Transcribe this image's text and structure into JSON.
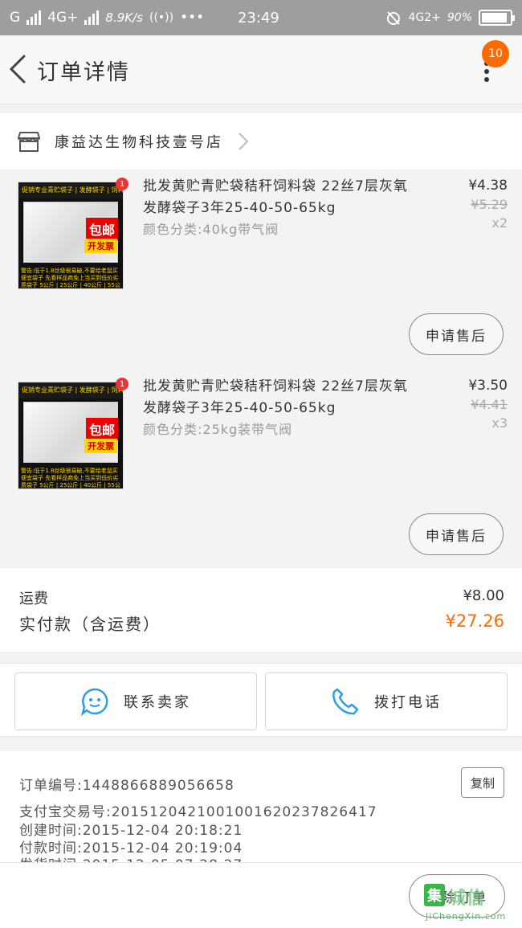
{
  "status_bar": {
    "carrier": "G",
    "net_type": "4G+",
    "speed": "8.9K/s",
    "dots": "•••",
    "time": "23:49",
    "net_type_right": "4G2+",
    "battery": "90%"
  },
  "nav": {
    "title": "订单详情",
    "badge_count": "10"
  },
  "shop": {
    "name": "康益达生物科技壹号店"
  },
  "product_image": {
    "top_text": "促销专业青贮袋子 | 发酵袋子 | 饲料袋",
    "red_label": "包邮",
    "yellow_label": "开发票",
    "bottom_text": "警告:低于1.8丝级很易破,不要给老鼠买便宜袋子 先看样品商免上当买到低价劣质袋子 5公斤 | 25公斤 | 40公斤 | 55公斤",
    "badge": "1"
  },
  "items": [
    {
      "title": "批发黄贮青贮袋秸秆饲料袋 22丝7层灰氧发酵袋子3年25-40-50-65kg",
      "sku": "颜色分类:40kg带气阀",
      "price": "¥4.38",
      "original_price": "¥5.29",
      "quantity": "x2",
      "after_sale_label": "申请售后"
    },
    {
      "title": "批发黄贮青贮袋秸秆饲料袋 22丝7层灰氧发酵袋子3年25-40-50-65kg",
      "sku": "颜色分类:25kg装带气阀",
      "price": "¥3.50",
      "original_price": "¥4.41",
      "quantity": "x3",
      "after_sale_label": "申请售后"
    }
  ],
  "fees": {
    "shipping_label": "运费",
    "shipping_value": "¥8.00",
    "paid_label": "实付款（含运费）",
    "paid_value": "¥27.26"
  },
  "actions": {
    "contact_seller": "联系卖家",
    "call_phone": "拨打电话"
  },
  "order_info": {
    "order_no": "订单编号:1448866889056658",
    "copy_label": "复制",
    "alipay_no": "支付宝交易号:2015120421001001620237826417",
    "created": "创建时间:2015-12-04 20:18:21",
    "paid": "付款时间:2015-12-04 20:19:04",
    "shipped": "发货时间:2015-12-05 07:28:27"
  },
  "bottom": {
    "delete_label": "删除订单"
  },
  "watermark": {
    "mark": "集",
    "cn": "城信",
    "url": "JiChengXin.com"
  },
  "colors": {
    "accent": "#ff6a00",
    "status_bar_bg": "#9e9e9e",
    "contact_icon": "#2a9fe8"
  }
}
